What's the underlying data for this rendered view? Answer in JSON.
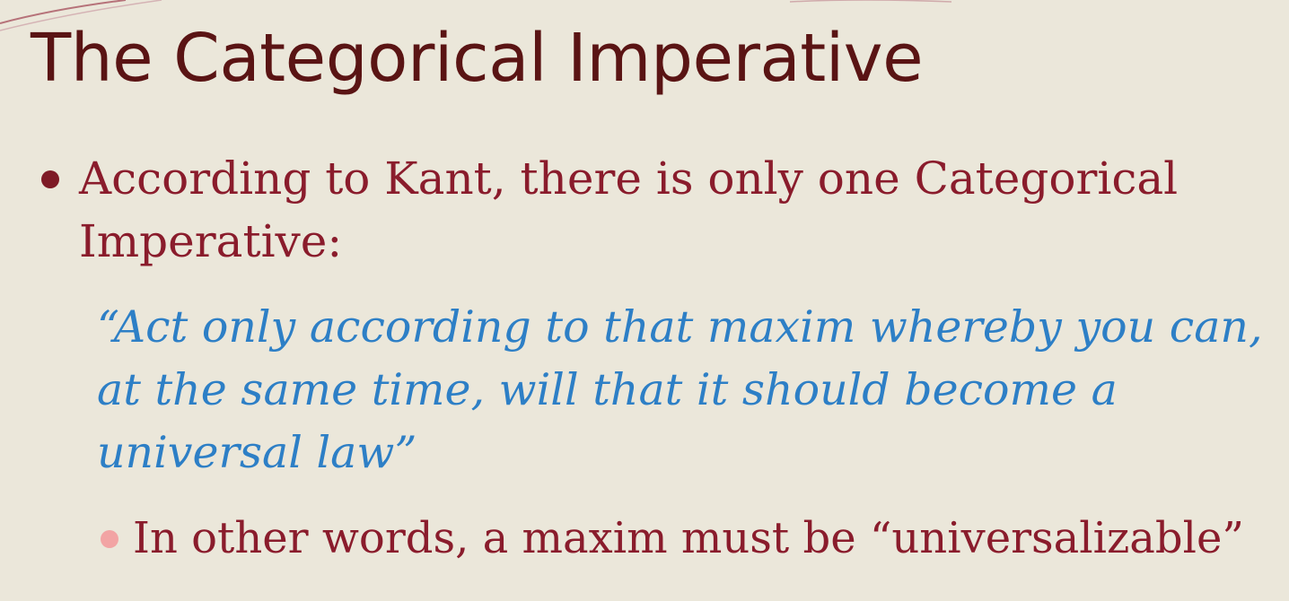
{
  "slide": {
    "title": "The Categorical Imperative",
    "bullet_1": "According to Kant, there is only one Categorical Imperative:",
    "quote": "“Act only according to that maxim whereby you can, at the same time, will that it should become a universal law”",
    "bullet_2": "In other words, a maxim must be “universalizable”"
  },
  "colors": {
    "background": "#ebe7da",
    "title": "#5a1414",
    "body_text": "#8a1c2c",
    "quote_text": "#2d7fc6",
    "bullet_primary": "#7e1a26",
    "bullet_secondary": "#f2a4a4",
    "swoosh": "#a04050"
  },
  "icons": {
    "bullet_1": "round-bullet-icon",
    "bullet_2": "round-bullet-icon"
  }
}
